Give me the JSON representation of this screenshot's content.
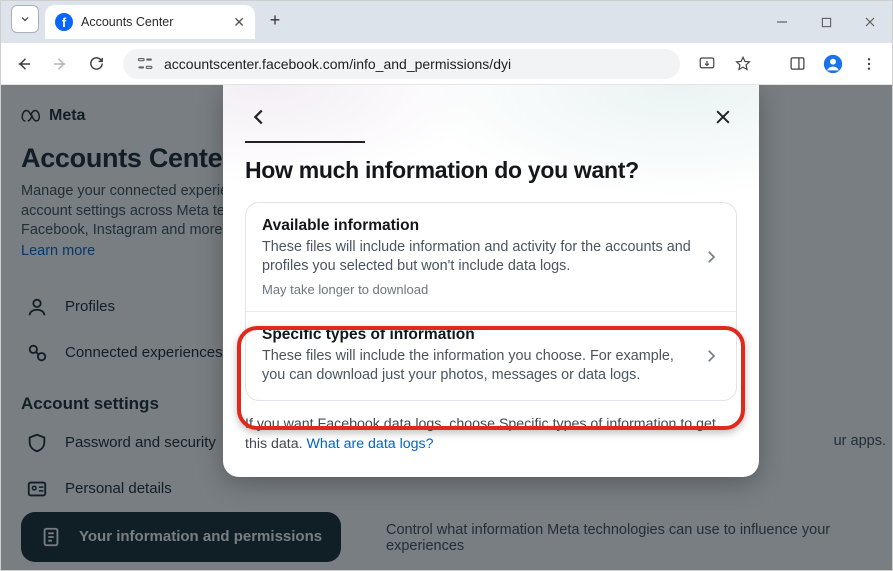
{
  "browser": {
    "tab_title": "Accounts Center",
    "url": "accountscenter.facebook.com/info_and_permissions/dyi"
  },
  "meta": {
    "brand": "Meta",
    "title": "Accounts Center",
    "desc": "Manage your connected experiences and account settings across Meta technologies like Facebook, Instagram and more.",
    "learn_more": "Learn more",
    "sidebar": {
      "profiles": "Profiles",
      "connected": "Connected experiences",
      "section": "Account settings",
      "password": "Password and security",
      "personal": "Personal details",
      "your_info": "Your information and permissions"
    },
    "right1": "ur apps.",
    "right2": "Control what information Meta technologies can use to influence your experiences"
  },
  "dialog": {
    "title": "How much information do you want?",
    "option1": {
      "title": "Available information",
      "desc": "These files will include information and activity for the accounts and profiles you selected but won't include data logs.",
      "sub": "May take longer to download"
    },
    "option2": {
      "title": "Specific types of information",
      "desc": "These files will include the information you choose. For example, you can download just your photos, messages or data logs."
    },
    "footer_text": "If you want Facebook data logs, choose Specific types of information to get this data. ",
    "footer_link": "What are data logs?"
  }
}
